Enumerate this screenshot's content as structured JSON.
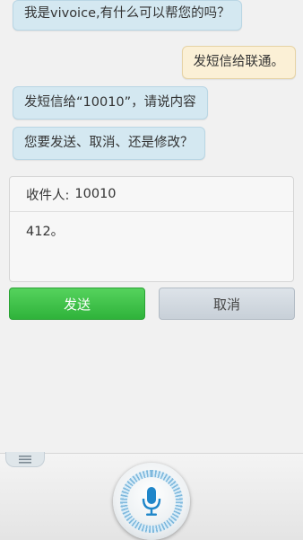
{
  "conversation": {
    "messages": [
      {
        "from": "assistant",
        "text": "我是vivoice,有什么可以帮您的吗？"
      },
      {
        "from": "user",
        "text": "发短信给联通。"
      },
      {
        "from": "assistant",
        "text": "发短信给“10010”，请说内容"
      },
      {
        "from": "assistant",
        "text": "您要发送、取消、还是修改？"
      }
    ]
  },
  "sms_card": {
    "recipient_label": "收件人:",
    "recipient_number": "10010",
    "content": "412。"
  },
  "actions": {
    "send_label": "发送",
    "cancel_label": "取消"
  },
  "bottom_bar": {
    "menu_icon": "menu-lines-icon",
    "mic_icon": "microphone-icon"
  },
  "colors": {
    "assistant_bubble": "#d4e8f1",
    "user_bubble": "#fbf0d6",
    "send_button": "#3cbf45",
    "cancel_button": "#d2d9e0",
    "mic_accent": "#1f86c9"
  }
}
